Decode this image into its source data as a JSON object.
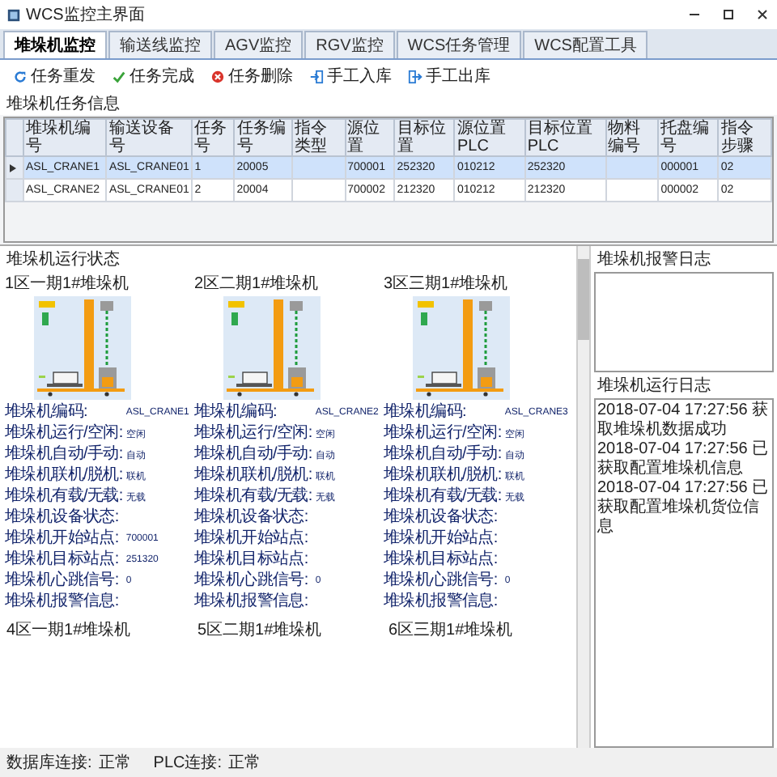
{
  "window": {
    "title": "WCS监控主界面"
  },
  "tabs": [
    {
      "label": "堆垛机监控",
      "selected": true
    },
    {
      "label": "输送线监控",
      "selected": false
    },
    {
      "label": "AGV监控",
      "selected": false
    },
    {
      "label": "RGV监控",
      "selected": false
    },
    {
      "label": "WCS任务管理",
      "selected": false
    },
    {
      "label": "WCS配置工具",
      "selected": false
    }
  ],
  "toolbar": [
    {
      "label": "任务重发",
      "kind": "refresh"
    },
    {
      "label": "任务完成",
      "kind": "check"
    },
    {
      "label": "任务删除",
      "kind": "delete"
    },
    {
      "label": "手工入库",
      "kind": "in"
    },
    {
      "label": "手工出库",
      "kind": "out"
    }
  ],
  "task_table": {
    "title": "堆垛机任务信息",
    "columns": [
      "堆垛机编号",
      "输送设备号",
      "任务号",
      "任务编号",
      "指令类型",
      "源位置",
      "目标位置",
      "源位置PLC",
      "目标位置PLC",
      "物料编号",
      "托盘编号",
      "指令步骤"
    ],
    "rows": [
      {
        "selected": true,
        "cells": [
          "ASL_CRANE1",
          "ASL_CRANE01",
          "1",
          "20005",
          "",
          "700001",
          "252320",
          "010212",
          "252320",
          "",
          "000001",
          "02"
        ]
      },
      {
        "selected": false,
        "cells": [
          "ASL_CRANE2",
          "ASL_CRANE01",
          "2",
          "20004",
          "",
          "700002",
          "212320",
          "010212",
          "212320",
          "",
          "000002",
          "02"
        ]
      }
    ]
  },
  "crane_panel": {
    "title": "堆垛机运行状态",
    "cranes": [
      {
        "title": "1区一期1#堆垛机",
        "fields": [
          {
            "label": "堆垛机编码:",
            "value": "ASL_CRANE1"
          },
          {
            "label": "堆垛机运行/空闲:",
            "value": "空闲"
          },
          {
            "label": "堆垛机自动/手动:",
            "value": "自动"
          },
          {
            "label": "堆垛机联机/脱机:",
            "value": "联机"
          },
          {
            "label": "堆垛机有载/无载:",
            "value": "无载"
          },
          {
            "label": "堆垛机设备状态:"
          },
          {
            "label": "堆垛机开始站点:",
            "value": "700001"
          },
          {
            "label": "堆垛机目标站点:",
            "value": "251320"
          },
          {
            "label": "堆垛机心跳信号:",
            "value": "0"
          },
          {
            "label": "堆垛机报警信息:"
          }
        ]
      },
      {
        "title": "2区二期1#堆垛机",
        "fields": [
          {
            "label": "堆垛机编码:",
            "value": "ASL_CRANE2"
          },
          {
            "label": "堆垛机运行/空闲:",
            "value": "空闲"
          },
          {
            "label": "堆垛机自动/手动:",
            "value": "自动"
          },
          {
            "label": "堆垛机联机/脱机:",
            "value": "联机"
          },
          {
            "label": "堆垛机有载/无载:",
            "value": "无载"
          },
          {
            "label": "堆垛机设备状态:"
          },
          {
            "label": "堆垛机开始站点:"
          },
          {
            "label": "堆垛机目标站点:"
          },
          {
            "label": "堆垛机心跳信号:",
            "value": "0"
          },
          {
            "label": "堆垛机报警信息:"
          }
        ]
      },
      {
        "title": "3区三期1#堆垛机",
        "fields": [
          {
            "label": "堆垛机编码:",
            "value": "ASL_CRANE3"
          },
          {
            "label": "堆垛机运行/空闲:",
            "value": "空闲"
          },
          {
            "label": "堆垛机自动/手动:",
            "value": "自动"
          },
          {
            "label": "堆垛机联机/脱机:",
            "value": "联机"
          },
          {
            "label": "堆垛机有载/无载:",
            "value": "无载"
          },
          {
            "label": "堆垛机设备状态:"
          },
          {
            "label": "堆垛机开始站点:"
          },
          {
            "label": "堆垛机目标站点:"
          },
          {
            "label": "堆垛机心跳信号:",
            "value": "0"
          },
          {
            "label": "堆垛机报警信息:"
          }
        ]
      }
    ],
    "next_row_titles": [
      "4区一期1#堆垛机",
      "5区二期1#堆垛机",
      "6区三期1#堆垛机"
    ]
  },
  "alarm_log": {
    "title": "堆垛机报警日志"
  },
  "run_log": {
    "title": "堆垛机运行日志",
    "lines": [
      {
        "time": "2018-07-04 17:27:56",
        "text": "获取堆垛机数据成功"
      },
      {
        "time": "2018-07-04 17:27:56",
        "text": "已获取配置堆垛机信息"
      },
      {
        "time": "2018-07-04 17:27:56",
        "text": "已获取配置堆垛机货位信息"
      }
    ]
  },
  "status_bar": [
    {
      "label": "数据库连接:",
      "value": "正常"
    },
    {
      "label": "PLC连接:",
      "value": "正常"
    }
  ]
}
